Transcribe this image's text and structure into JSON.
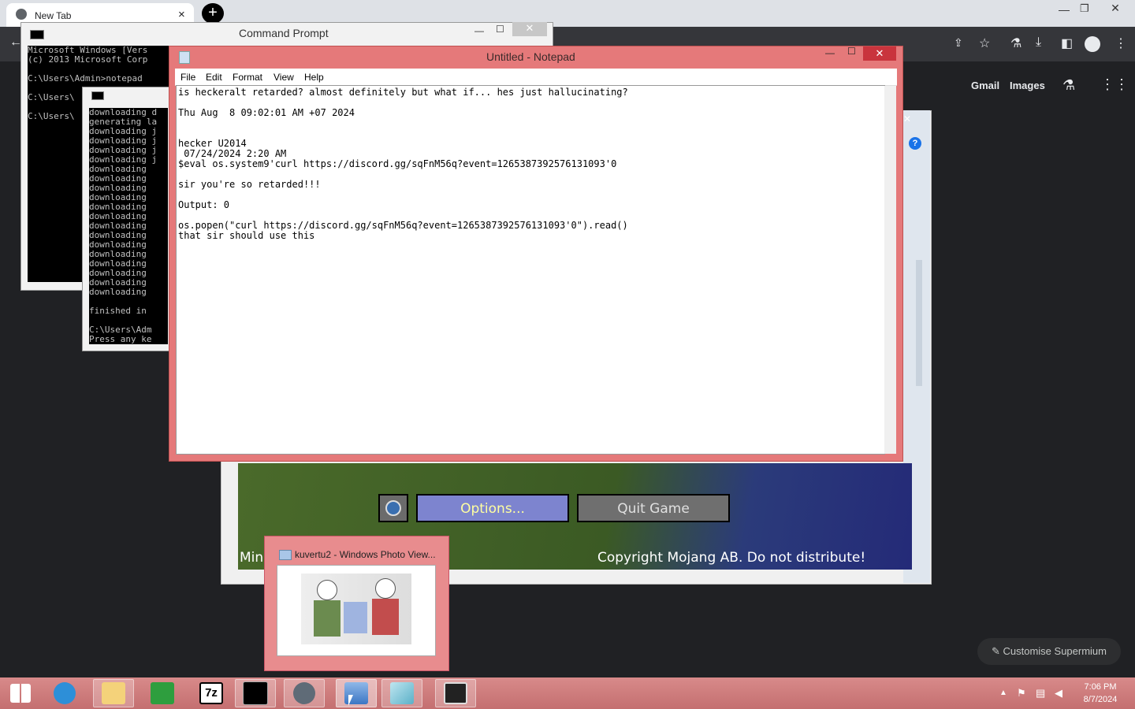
{
  "chrome": {
    "tab_title": "New Tab",
    "tab_close": "×",
    "new_tab": "+",
    "links": {
      "gmail": "Gmail",
      "images": "Images"
    },
    "customise": "Customise Supermium"
  },
  "cmd1": {
    "title": "Command Prompt",
    "lines": "Microsoft Windows [Vers\n(c) 2013 Microsoft Corp\n\nC:\\Users\\Admin>notepad\n\nC:\\Users\\\n\nC:\\Users\\"
  },
  "cmd2": {
    "lines": "downloading d\ngenerating la\ndownloading j\ndownloading j\ndownloading j\ndownloading j\ndownloading\ndownloading\ndownloading\ndownloading\ndownloading\ndownloading\ndownloading\ndownloading\ndownloading\ndownloading\ndownloading\ndownloading\ndownloading\ndownloading\n\nfinished in\n\nC:\\Users\\Adm\nPress any ke"
  },
  "notepad": {
    "title": "Untitled - Notepad",
    "menu": [
      "File",
      "Edit",
      "Format",
      "View",
      "Help"
    ],
    "text": "is heckeralt retarded? almost definitely but what if... hes just hallucinating?\n\nThu Aug  8 09:02:01 AM +07 2024\n\n\nhecker U2014\n 07/24/2024 2:20 AM\n$eval os.system9'curl https://discord.gg/sqFnM56q?event=1265387392576131093'0\n\nsir you're so retarded!!!\n\nOutput: 0\n\nos.popen(\"curl https://discord.gg/sqFnM56q?event=1265387392576131093'0\").read()\nthat sir should use this"
  },
  "minecraft": {
    "options": "Options...",
    "quit": "Quit Game",
    "left_text": "Min",
    "copyright": "Copyright Mojang AB. Do not distribute!"
  },
  "thumbnail": {
    "title": "kuvertu2 - Windows Photo View..."
  },
  "tray": {
    "time": "7:06 PM",
    "date": "8/7/2024"
  },
  "taskbar_items": [
    "start",
    "internet-explorer",
    "file-explorer",
    "store",
    "7zip",
    "command-prompt",
    "chrome",
    "photo-viewer",
    "notepad",
    "minecraft"
  ]
}
